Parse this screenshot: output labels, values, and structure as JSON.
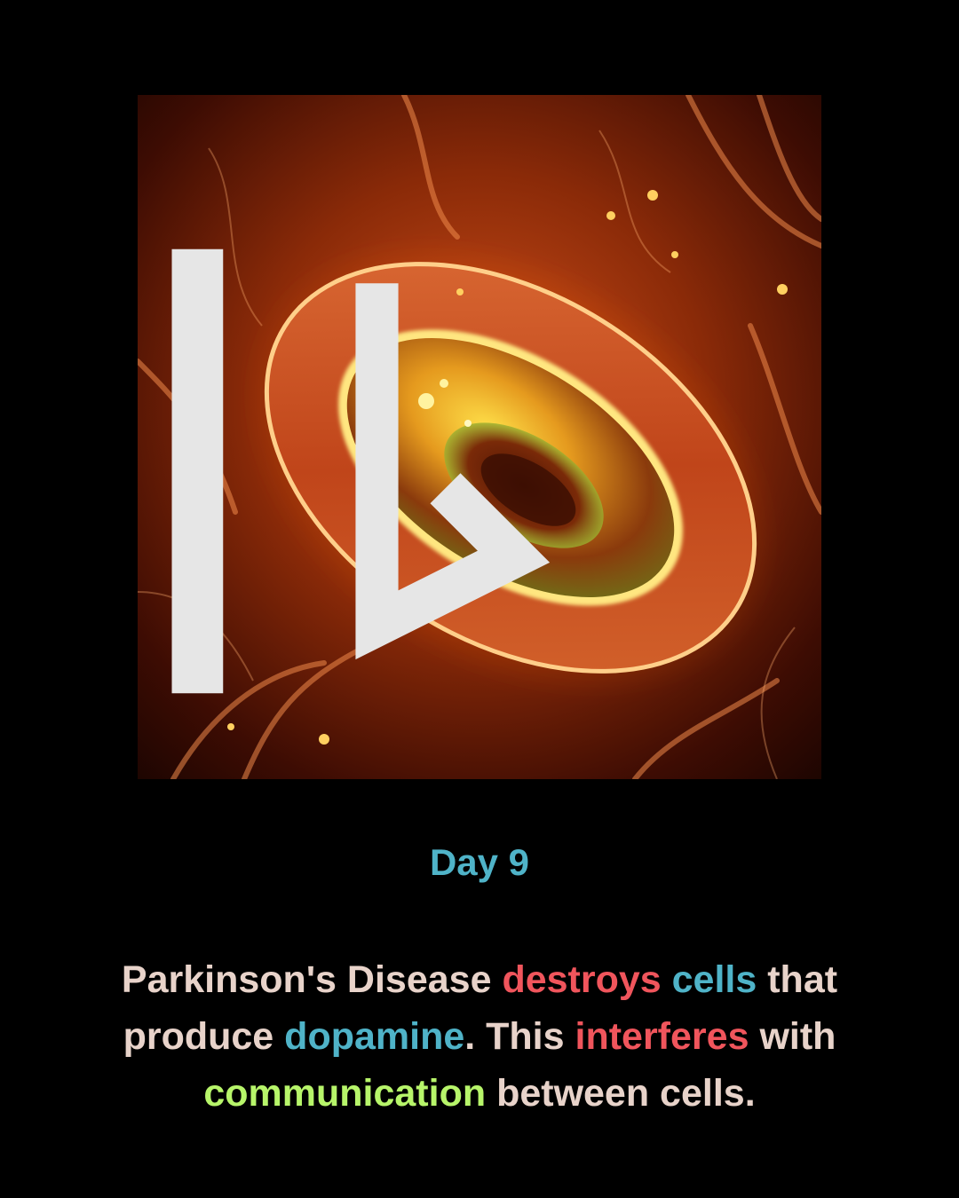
{
  "colors": {
    "background": "#000000",
    "title": "#4fb3c8",
    "body_text": "#e8d3ca",
    "red_highlight": "#f0555c",
    "blue_highlight": "#4fb3c8",
    "green_highlight": "#b7f56a"
  },
  "image": {
    "subject": "glowing orange cell illustration",
    "watermark_icon": "bing-logo-icon"
  },
  "title": "Day 9",
  "caption": {
    "w1": "Parkinson's Disease",
    "w2": "destroys",
    "w3": "cells",
    "w4": "that produce",
    "w5": "dopamine",
    "w6": ". This",
    "w7": "interferes",
    "w8": "with",
    "w9": "communication",
    "w10": "between cells."
  }
}
